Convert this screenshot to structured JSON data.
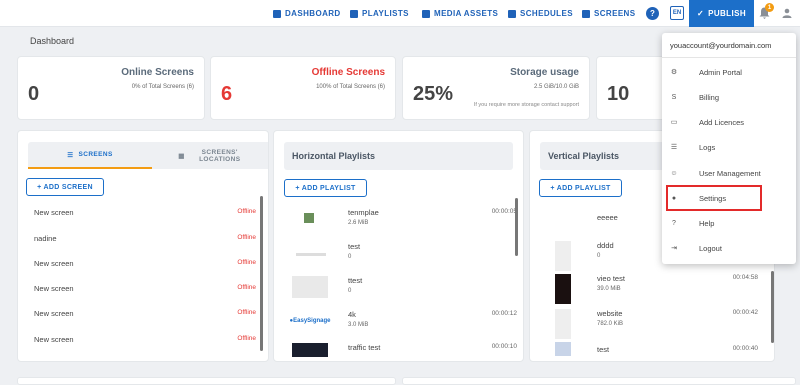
{
  "nav": {
    "dashboard": "DASHBOARD",
    "playlists": "PLAYLISTS",
    "media_assets": "MEDIA ASSETS",
    "schedules": "SCHEDULES",
    "screens": "SCREENS",
    "help": "?",
    "lang": "EN",
    "publish": "PUBLISH",
    "notification_count": "1"
  },
  "page": {
    "title": "Dashboard"
  },
  "stats": {
    "online": {
      "value": "0",
      "title": "Online Screens",
      "sub": "0% of Total Screens (6)"
    },
    "offline": {
      "value": "6",
      "title": "Offline Screens",
      "sub": "100% of Total Screens (6)"
    },
    "storage": {
      "value": "25%",
      "title": "Storage usage",
      "sub": "2.5 GiB/10.0 GiB",
      "note": "If you require more storage contact support"
    },
    "fourth": {
      "value": "10"
    }
  },
  "screens_panel": {
    "tab_screens": "SCREENS",
    "tab_locations": "SCREENS' LOCATIONS",
    "add": "+ ADD SCREEN",
    "rows": [
      {
        "name": "New screen",
        "status": "Offline"
      },
      {
        "name": "nadine",
        "status": "Offline"
      },
      {
        "name": "New screen",
        "status": "Offline"
      },
      {
        "name": "New screen",
        "status": "Offline"
      },
      {
        "name": "New screen",
        "status": "Offline"
      },
      {
        "name": "New screen",
        "status": "Offline"
      }
    ]
  },
  "horizontal": {
    "title": "Horizontal Playlists",
    "add": "+ ADD PLAYLIST",
    "items": [
      {
        "name": "tenmplae",
        "size": "2.6 MiB",
        "time": "00:00:05"
      },
      {
        "name": "test",
        "size": "0",
        "time": ""
      },
      {
        "name": "ttest",
        "size": "0",
        "time": ""
      },
      {
        "name": "4k",
        "size": "3.0 MiB",
        "time": "00:00:12"
      },
      {
        "name": "traffic test",
        "size": "",
        "time": "00:00:10"
      }
    ]
  },
  "vertical": {
    "title": "Vertical Playlists",
    "add": "+ ADD PLAYLIST",
    "items": [
      {
        "name": "eeeee",
        "size": "",
        "time": ""
      },
      {
        "name": "dddd",
        "size": "0",
        "time": ""
      },
      {
        "name": "vieo test",
        "size": "39.0 MiB",
        "time": "00:04:58"
      },
      {
        "name": "website",
        "size": "782.0 KiB",
        "time": "00:00:42"
      },
      {
        "name": "test",
        "size": "",
        "time": "00:00:40"
      }
    ]
  },
  "menu": {
    "email": "youaccount@yourdomain.com",
    "items": [
      {
        "label": "Admin Portal",
        "icon": "gear-icon",
        "glyph": "⚙"
      },
      {
        "label": "Billing",
        "icon": "dollar-icon",
        "glyph": "S"
      },
      {
        "label": "Add Licences",
        "icon": "card-icon",
        "glyph": "▭"
      },
      {
        "label": "Logs",
        "icon": "list-icon",
        "glyph": "☰"
      },
      {
        "label": "User Management",
        "icon": "users-icon",
        "glyph": "☺"
      },
      {
        "label": "Settings",
        "icon": "user-icon",
        "glyph": "●"
      },
      {
        "label": "Help",
        "icon": "help-icon",
        "glyph": "?"
      },
      {
        "label": "Logout",
        "icon": "logout-icon",
        "glyph": "⇥"
      }
    ]
  },
  "colors": {
    "accent": "#1c6fc9",
    "offline": "#e53935",
    "highlight": "#e32a2a",
    "badge": "#f39c12"
  }
}
